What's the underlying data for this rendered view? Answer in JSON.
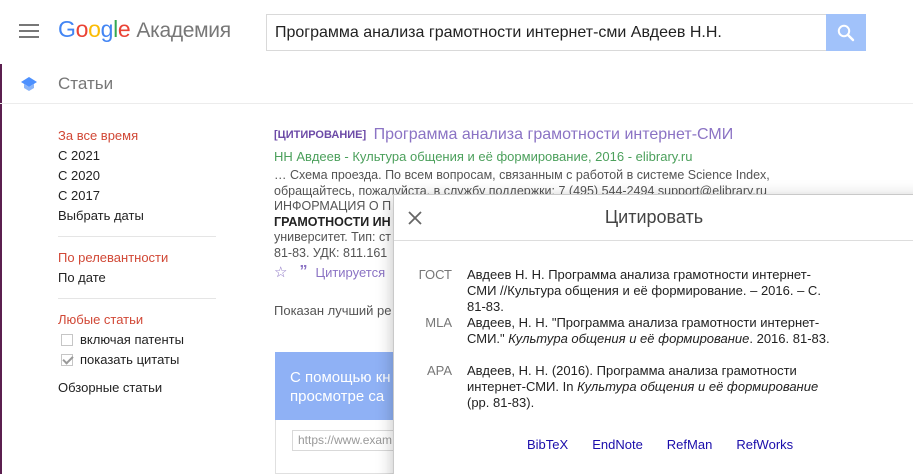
{
  "header": {
    "logo_letters": [
      "G",
      "o",
      "o",
      "g",
      "l",
      "e"
    ],
    "logo_suffix": "Академия",
    "search_query": "Программа анализа грамотности интернет-сми Авдеев Н.Н."
  },
  "subbar": {
    "title": "Статьи"
  },
  "sidebar": {
    "time_head": "За все время",
    "time_items": [
      "С 2021",
      "С 2020",
      "С 2017",
      "Выбрать даты"
    ],
    "sort_head": "По релевантности",
    "sort_other": "По дате",
    "type_head": "Любые статьи",
    "include_patents": "включая патенты",
    "include_patents_checked": false,
    "show_citations": "показать цитаты",
    "show_citations_checked": true,
    "review_articles": "Обзорные статьи"
  },
  "result": {
    "type_tag": "[ЦИТИРОВАНИЕ]",
    "title": "Программа анализа грамотности интернет-СМИ",
    "authors_line": "НН Авдеев - Культура общения и её формирование, 2016 - elibrary.ru",
    "snippet_1": "… Схема проезда. По всем вопросам, связанным с работой в системе Science Index,",
    "snippet_2": "обращайтесь, пожалуйста, в службу поддержки: 7 (495) 544-2494 support@elibrary.ru",
    "snippet_3": "ИНФОРМАЦИЯ О П",
    "snippet_4_bold": "ГРАМОТНОСТИ ИН",
    "snippet_5": "университет. Тип: ст",
    "snippet_6": "81-83. УДК: 811.161",
    "cited_label": "Цитируется",
    "shown_best": "Показан лучший ре"
  },
  "promo": {
    "line1": "С помощью кн",
    "line2": "просмотре са",
    "url_placeholder": "https://www.exam"
  },
  "modal": {
    "title": "Цитировать",
    "citations": [
      {
        "label": "ГОСТ",
        "text_a": "Авдеев Н. Н. Программа анализа грамотности интернет-СМИ //Культура общения и её формирование. – 2016. – С. 81-83.",
        "italic": "",
        "text_b": ""
      },
      {
        "label": "MLA",
        "text_a": "Авдеев, Н. Н. \"Программа анализа грамотности интернет-СМИ.\" ",
        "italic": "Культура общения и её формирование",
        "text_b": ". 2016. 81-83."
      },
      {
        "label": "APA",
        "text_a": "Авдеев, Н. Н. (2016). Программа анализа грамотности интернет-СМИ. In ",
        "italic": "Культура общения и её формирование",
        "text_b": " (pp. 81-83)."
      }
    ],
    "export_links": [
      "BibTeX",
      "EndNote",
      "RefMan",
      "RefWorks"
    ]
  },
  "colors": {
    "accent_purple": "#8b73c4",
    "author_green": "#4ca05c",
    "sidebar_head_red": "#d14836",
    "search_button_blue": "#a1c2fa",
    "link_blue": "#1a0dab"
  }
}
